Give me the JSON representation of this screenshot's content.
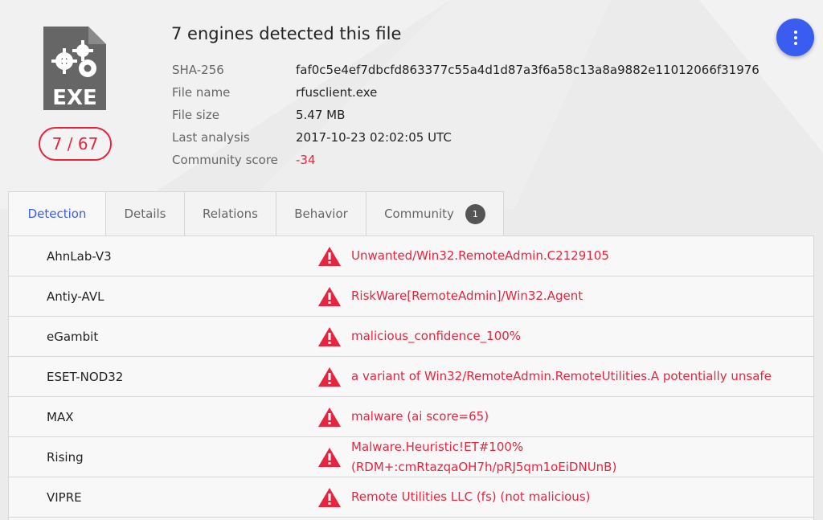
{
  "file": {
    "icon": "exe-file-icon",
    "icon_label": "EXE",
    "score": "7 / 67",
    "title": "7 engines detected this file"
  },
  "meta": [
    {
      "key": "SHA-256",
      "value": "faf0c5e4ef7dbcfd863377c55a4d1d87a3f6a58c13a8a9882e11012066f31976"
    },
    {
      "key": "File name",
      "value": "rfusclient.exe"
    },
    {
      "key": "File size",
      "value": "5.47 MB"
    },
    {
      "key": "Last analysis",
      "value": "2017-10-23 02:02:05 UTC"
    },
    {
      "key": "Community score",
      "value": "-34"
    }
  ],
  "tabs": [
    {
      "label": "Detection"
    },
    {
      "label": "Details"
    },
    {
      "label": "Relations"
    },
    {
      "label": "Behavior"
    },
    {
      "label": "Community",
      "badge": "1"
    }
  ],
  "detections": [
    {
      "engine": "AhnLab-V3",
      "result": "Unwanted/Win32.RemoteAdmin.C2129105"
    },
    {
      "engine": "Antiy-AVL",
      "result": "RiskWare[RemoteAdmin]/Win32.Agent"
    },
    {
      "engine": "eGambit",
      "result": "malicious_confidence_100%"
    },
    {
      "engine": "ESET-NOD32",
      "result": "a variant of Win32/RemoteAdmin.RemoteUtilities.A potentially unsafe"
    },
    {
      "engine": "MAX",
      "result": "malware (ai score=65)"
    },
    {
      "engine": "Rising",
      "result": "Malware.Heuristic!ET#100% (RDM+:cmRtazqaOH7h/pRJ5qm1oEiDNUnB)"
    },
    {
      "engine": "VIPRE",
      "result": "Remote Utilities LLC (fs) (not malicious)"
    }
  ],
  "colors": {
    "accent": "#3a5cf0",
    "danger": "#e8243f",
    "icon_gray": "#666666"
  }
}
